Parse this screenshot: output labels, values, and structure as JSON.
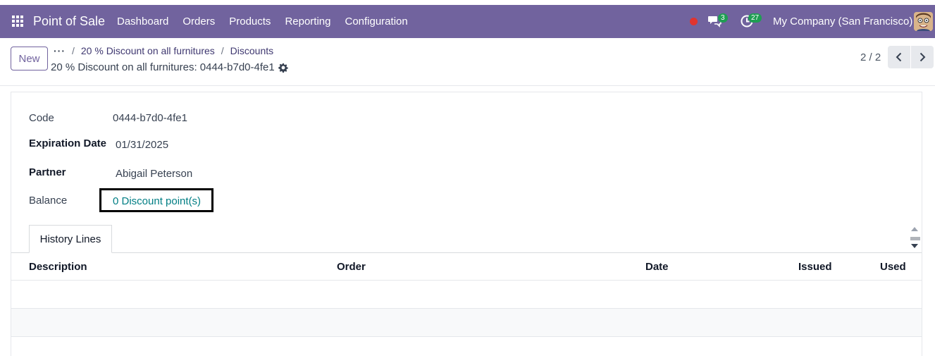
{
  "navbar": {
    "app_title": "Point of Sale",
    "menu": [
      "Dashboard",
      "Orders",
      "Products",
      "Reporting",
      "Configuration"
    ],
    "messages_count": "3",
    "activities_count": "27",
    "company": "My Company (San Francisco)",
    "accent_color": "#71639e"
  },
  "control_panel": {
    "new_label": "New",
    "breadcrumb_more": "···",
    "breadcrumb_sep": "/",
    "breadcrumbs": [
      "20 % Discount on all furnitures",
      "Discounts"
    ],
    "record_title": "20 % Discount on all furnitures: 0444-b7d0-4fe1",
    "pager": "2 / 2"
  },
  "form": {
    "code_label": "Code",
    "code_value": "0444-b7d0-4fe1",
    "expiration_label": "Expiration Date",
    "expiration_value": "01/31/2025",
    "partner_label": "Partner",
    "partner_value": "Abigail Peterson",
    "balance_label": "Balance",
    "balance_value": "0 Discount point(s)"
  },
  "tabs": [
    "History Lines"
  ],
  "history_table": {
    "columns": [
      "Description",
      "Order",
      "Date",
      "Issued",
      "Used"
    ],
    "rows": []
  }
}
